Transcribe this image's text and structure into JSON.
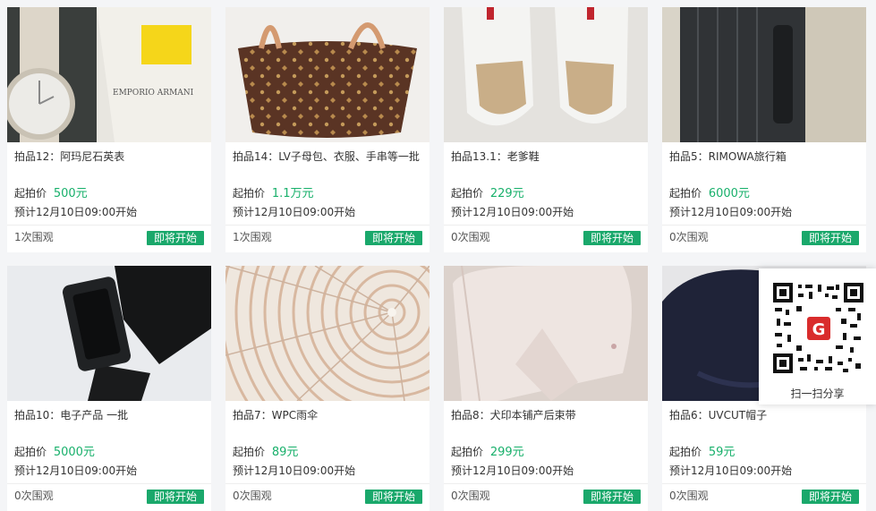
{
  "colors": {
    "accent": "#18b06b",
    "button": "#1aa86b"
  },
  "lots": [
    {
      "title": "拍品12：阿玛尼石英表",
      "price_label": "起拍价",
      "price": "500元",
      "time": "预计12月10日09:00开始",
      "views": "1次围观",
      "status": "即将开始",
      "image": "watch-icon"
    },
    {
      "title": "拍品14：LV子母包、衣服、手串等一批",
      "price_label": "起拍价",
      "price": "1.1万元",
      "time": "预计12月10日09:00开始",
      "views": "1次围观",
      "status": "即将开始",
      "image": "handbag-icon"
    },
    {
      "title": "拍品13.1：老爹鞋",
      "price_label": "起拍价",
      "price": "229元",
      "time": "预计12月10日09:00开始",
      "views": "0次围观",
      "status": "即将开始",
      "image": "sneakers-icon"
    },
    {
      "title": "拍品5：RIMOWA旅行箱",
      "price_label": "起拍价",
      "price": "6000元",
      "time": "预计12月10日09:00开始",
      "views": "0次围观",
      "status": "即将开始",
      "image": "suitcase-icon"
    },
    {
      "title": "拍品10：电子产品 一批",
      "price_label": "起拍价",
      "price": "5000元",
      "time": "预计12月10日09:00开始",
      "views": "0次围观",
      "status": "即将开始",
      "image": "smartwatch-icon"
    },
    {
      "title": "拍品7：WPC雨伞",
      "price_label": "起拍价",
      "price": "89元",
      "time": "预计12月10日09:00开始",
      "views": "0次围观",
      "status": "即将开始",
      "image": "umbrella-icon"
    },
    {
      "title": "拍品8：犬印本铺产后束带",
      "price_label": "起拍价",
      "price": "299元",
      "time": "预计12月10日09:00开始",
      "views": "0次围观",
      "status": "即将开始",
      "image": "belt-icon"
    },
    {
      "title": "拍品6：UVCUT帽子",
      "price_label": "起拍价",
      "price": "59元",
      "time": "预计12月10日09:00开始",
      "views": "0次围观",
      "status": "即将开始",
      "image": "hat-icon"
    }
  ],
  "share": {
    "caption": "扫一扫分享",
    "icon": "qr-code-icon"
  }
}
